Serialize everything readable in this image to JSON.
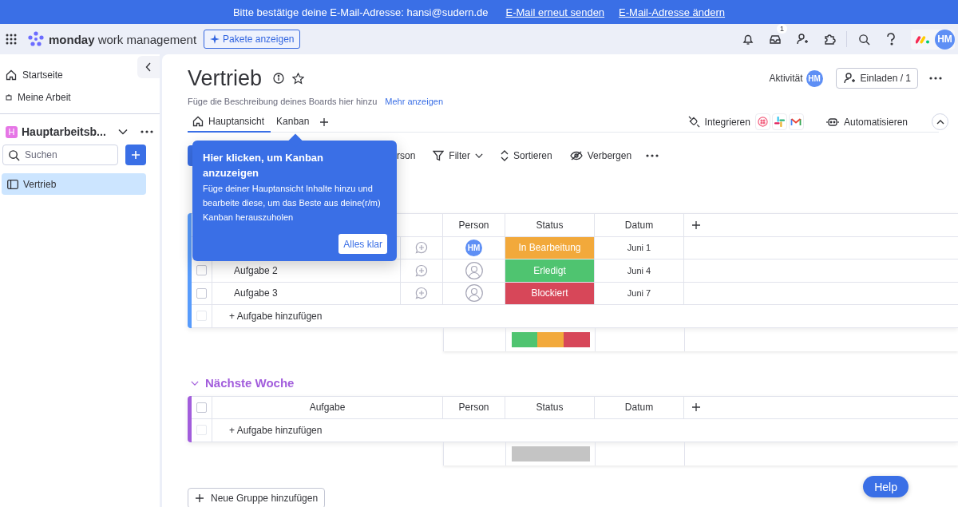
{
  "banner": {
    "text": "Bitte bestätige deine E-Mail-Adresse: hansi@sudern.de",
    "links": [
      "E-Mail erneut senden",
      "E-Mail-Adresse ändern"
    ]
  },
  "topbar": {
    "brand": "monday",
    "product": "work management",
    "plans_button": "Pakete anzeigen",
    "inbox_badge": "1",
    "avatar": "HM"
  },
  "sidebar": {
    "nav": [
      {
        "label": "Startseite",
        "kind": "home"
      },
      {
        "label": "Meine Arbeit",
        "kind": "work"
      }
    ],
    "workspace": "Hauptarbeitsb...",
    "workspace_initial": "H",
    "search": {
      "placeholder": "Suchen"
    },
    "boards": [
      {
        "label": "Vertrieb",
        "selected": true
      }
    ]
  },
  "board": {
    "title": "Vertrieb",
    "description": "Füge die Beschreibung deines Boards hier hinzu",
    "more_link": "Mehr anzeigen",
    "activity": "Aktivität",
    "activity_avatar": "HM",
    "invite": "Einladen / 1",
    "tabs": [
      {
        "label": "Hauptansicht",
        "selected": true
      },
      {
        "label": "Kanban",
        "selected": false
      }
    ],
    "integrate": "Integrieren",
    "automate": "Automatisieren",
    "toolbar": [
      {
        "label": "rson",
        "kind": "person"
      },
      {
        "label": "Filter",
        "kind": "filter"
      },
      {
        "label": "Sortieren",
        "kind": "sort"
      },
      {
        "label": "Verbergen",
        "kind": "hide"
      }
    ]
  },
  "groups": [
    {
      "color": "#579bfc",
      "columns": {
        "person": "Person",
        "status": "Status",
        "date": "Datum"
      },
      "rows": [
        {
          "person": "HM",
          "status": "In Bearbeitung",
          "color": "#f2a93b",
          "date": "Juni 1"
        },
        {
          "checked": false,
          "task": "Aufgabe 2",
          "status": "Erledigt",
          "color": "#4fc470",
          "date": "Juni 4"
        },
        {
          "checked": false,
          "task": "Aufgabe 3",
          "status": "Blockiert",
          "color": "#d74759",
          "date": "Juni 7"
        }
      ],
      "add_row": {
        "label": "+ Aufgabe hinzufügen",
        "checked": false
      },
      "summary": [
        {
          "color": "#4fc470"
        },
        {
          "color": "#f2a93b"
        },
        {
          "color": "#d74759"
        }
      ]
    },
    {
      "title": "Nächste Woche",
      "color": "#a25ddc",
      "select_all": {
        "checked": false
      },
      "columns": {
        "task": "Aufgabe",
        "person": "Person",
        "status": "Status",
        "date": "Datum"
      },
      "add_row": {
        "label": "+ Aufgabe hinzufügen",
        "checked": false
      },
      "summary": [
        {
          "color": "#c4c4c4"
        }
      ]
    }
  ],
  "new_group": "Neue Gruppe hinzufügen",
  "popover": {
    "title": "Hier klicken, um Kanban anzuzeigen",
    "body": "Füge deiner Hauptansicht Inhalte hinzu und bearbeite diese, um das Beste aus deine(r/m) Kanban herauszuholen",
    "button": "Alles klar"
  },
  "help": "Help"
}
